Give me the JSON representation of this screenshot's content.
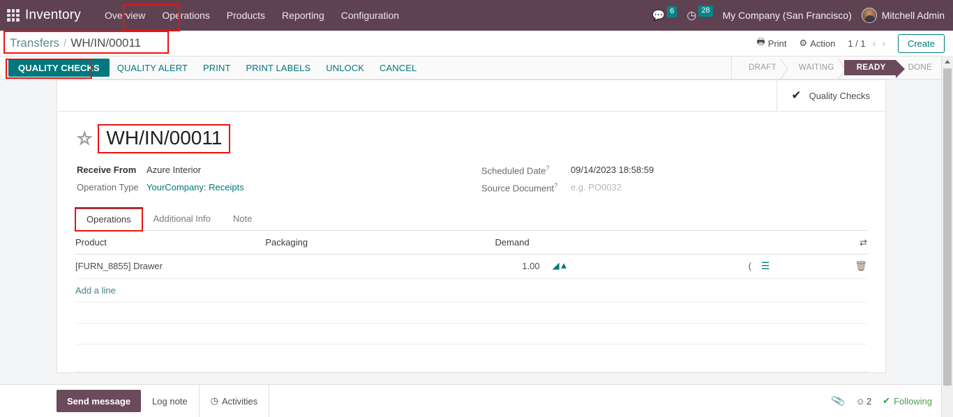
{
  "navbar": {
    "apps_icon": "grid-apps-icon",
    "brand": "Inventory",
    "menus": [
      {
        "label": "Overview"
      },
      {
        "label": "Operations"
      },
      {
        "label": "Products"
      },
      {
        "label": "Reporting"
      },
      {
        "label": "Configuration"
      }
    ],
    "messages_count": "6",
    "activities_count": "28",
    "company": "My Company (San Francisco)",
    "user": "Mitchell Admin"
  },
  "control_panel": {
    "breadcrumb_root": "Transfers",
    "breadcrumb_sep": "/",
    "breadcrumb_current": "WH/IN/00011",
    "print_label": "Print",
    "action_label": "Action",
    "pager": "1 / 1",
    "prev_arrow": "‹",
    "next_arrow": "›",
    "create_label": "Create"
  },
  "statusbar": {
    "buttons": [
      {
        "label": "QUALITY CHECKS",
        "primary": true
      },
      {
        "label": "QUALITY ALERT",
        "primary": false
      },
      {
        "label": "PRINT",
        "primary": false
      },
      {
        "label": "PRINT LABELS",
        "primary": false
      },
      {
        "label": "UNLOCK",
        "primary": false
      },
      {
        "label": "CANCEL",
        "primary": false
      }
    ],
    "stages": [
      {
        "label": "DRAFT",
        "active": false
      },
      {
        "label": "WAITING",
        "active": false
      },
      {
        "label": "READY",
        "active": true
      },
      {
        "label": "DONE",
        "active": false
      }
    ]
  },
  "sheet": {
    "stat_button": {
      "label": "Quality Checks",
      "icon": "check-icon",
      "glyph": "✔"
    },
    "star_glyph": "☆",
    "title": "WH/IN/00011",
    "fields_left": [
      {
        "label": "Receive From",
        "value": "Azure Interior",
        "strong": true,
        "link": false,
        "help": false,
        "placeholder": false
      },
      {
        "label": "Operation Type",
        "value": "YourCompany: Receipts",
        "strong": false,
        "link": true,
        "help": false,
        "placeholder": false
      }
    ],
    "fields_right": [
      {
        "label": "Scheduled Date",
        "value": "09/14/2023 18:58:59",
        "strong": false,
        "link": false,
        "help": true,
        "placeholder": false
      },
      {
        "label": "Source Document",
        "value": "e.g. PO0032",
        "strong": false,
        "link": false,
        "help": true,
        "placeholder": true
      }
    ],
    "tabs": [
      {
        "label": "Operations",
        "active": true
      },
      {
        "label": "Additional Info",
        "active": false
      },
      {
        "label": "Note",
        "active": false
      }
    ],
    "table": {
      "columns": [
        "Product",
        "Packaging",
        "Demand"
      ],
      "optional_columns_icon": "sliders-icon",
      "rows": [
        {
          "product": "[FURN_8855] Drawer",
          "packaging": "",
          "demand": "1.00",
          "forecast_icon": "forecast-chart-icon",
          "paren_glyph": "(",
          "detail_icon": "detailed-operations-icon",
          "delete_icon": "trash-icon"
        }
      ],
      "add_line_label": "Add a line"
    }
  },
  "chatter": {
    "send_message_label": "Send message",
    "log_note_label": "Log note",
    "activities_label": "Activities",
    "activities_icon": "clock-icon",
    "attachment_icon": "paperclip-icon",
    "followers_icon": "user-icon",
    "followers_count": "2",
    "following_label": "Following",
    "following_icon": "check-icon"
  },
  "colors": {
    "navbar_bg": "#5f4252",
    "accent_teal": "#00787d",
    "stage_active": "#6b4a5b",
    "annotation_red": "#ee1111",
    "following_green": "#4a9e4a"
  }
}
